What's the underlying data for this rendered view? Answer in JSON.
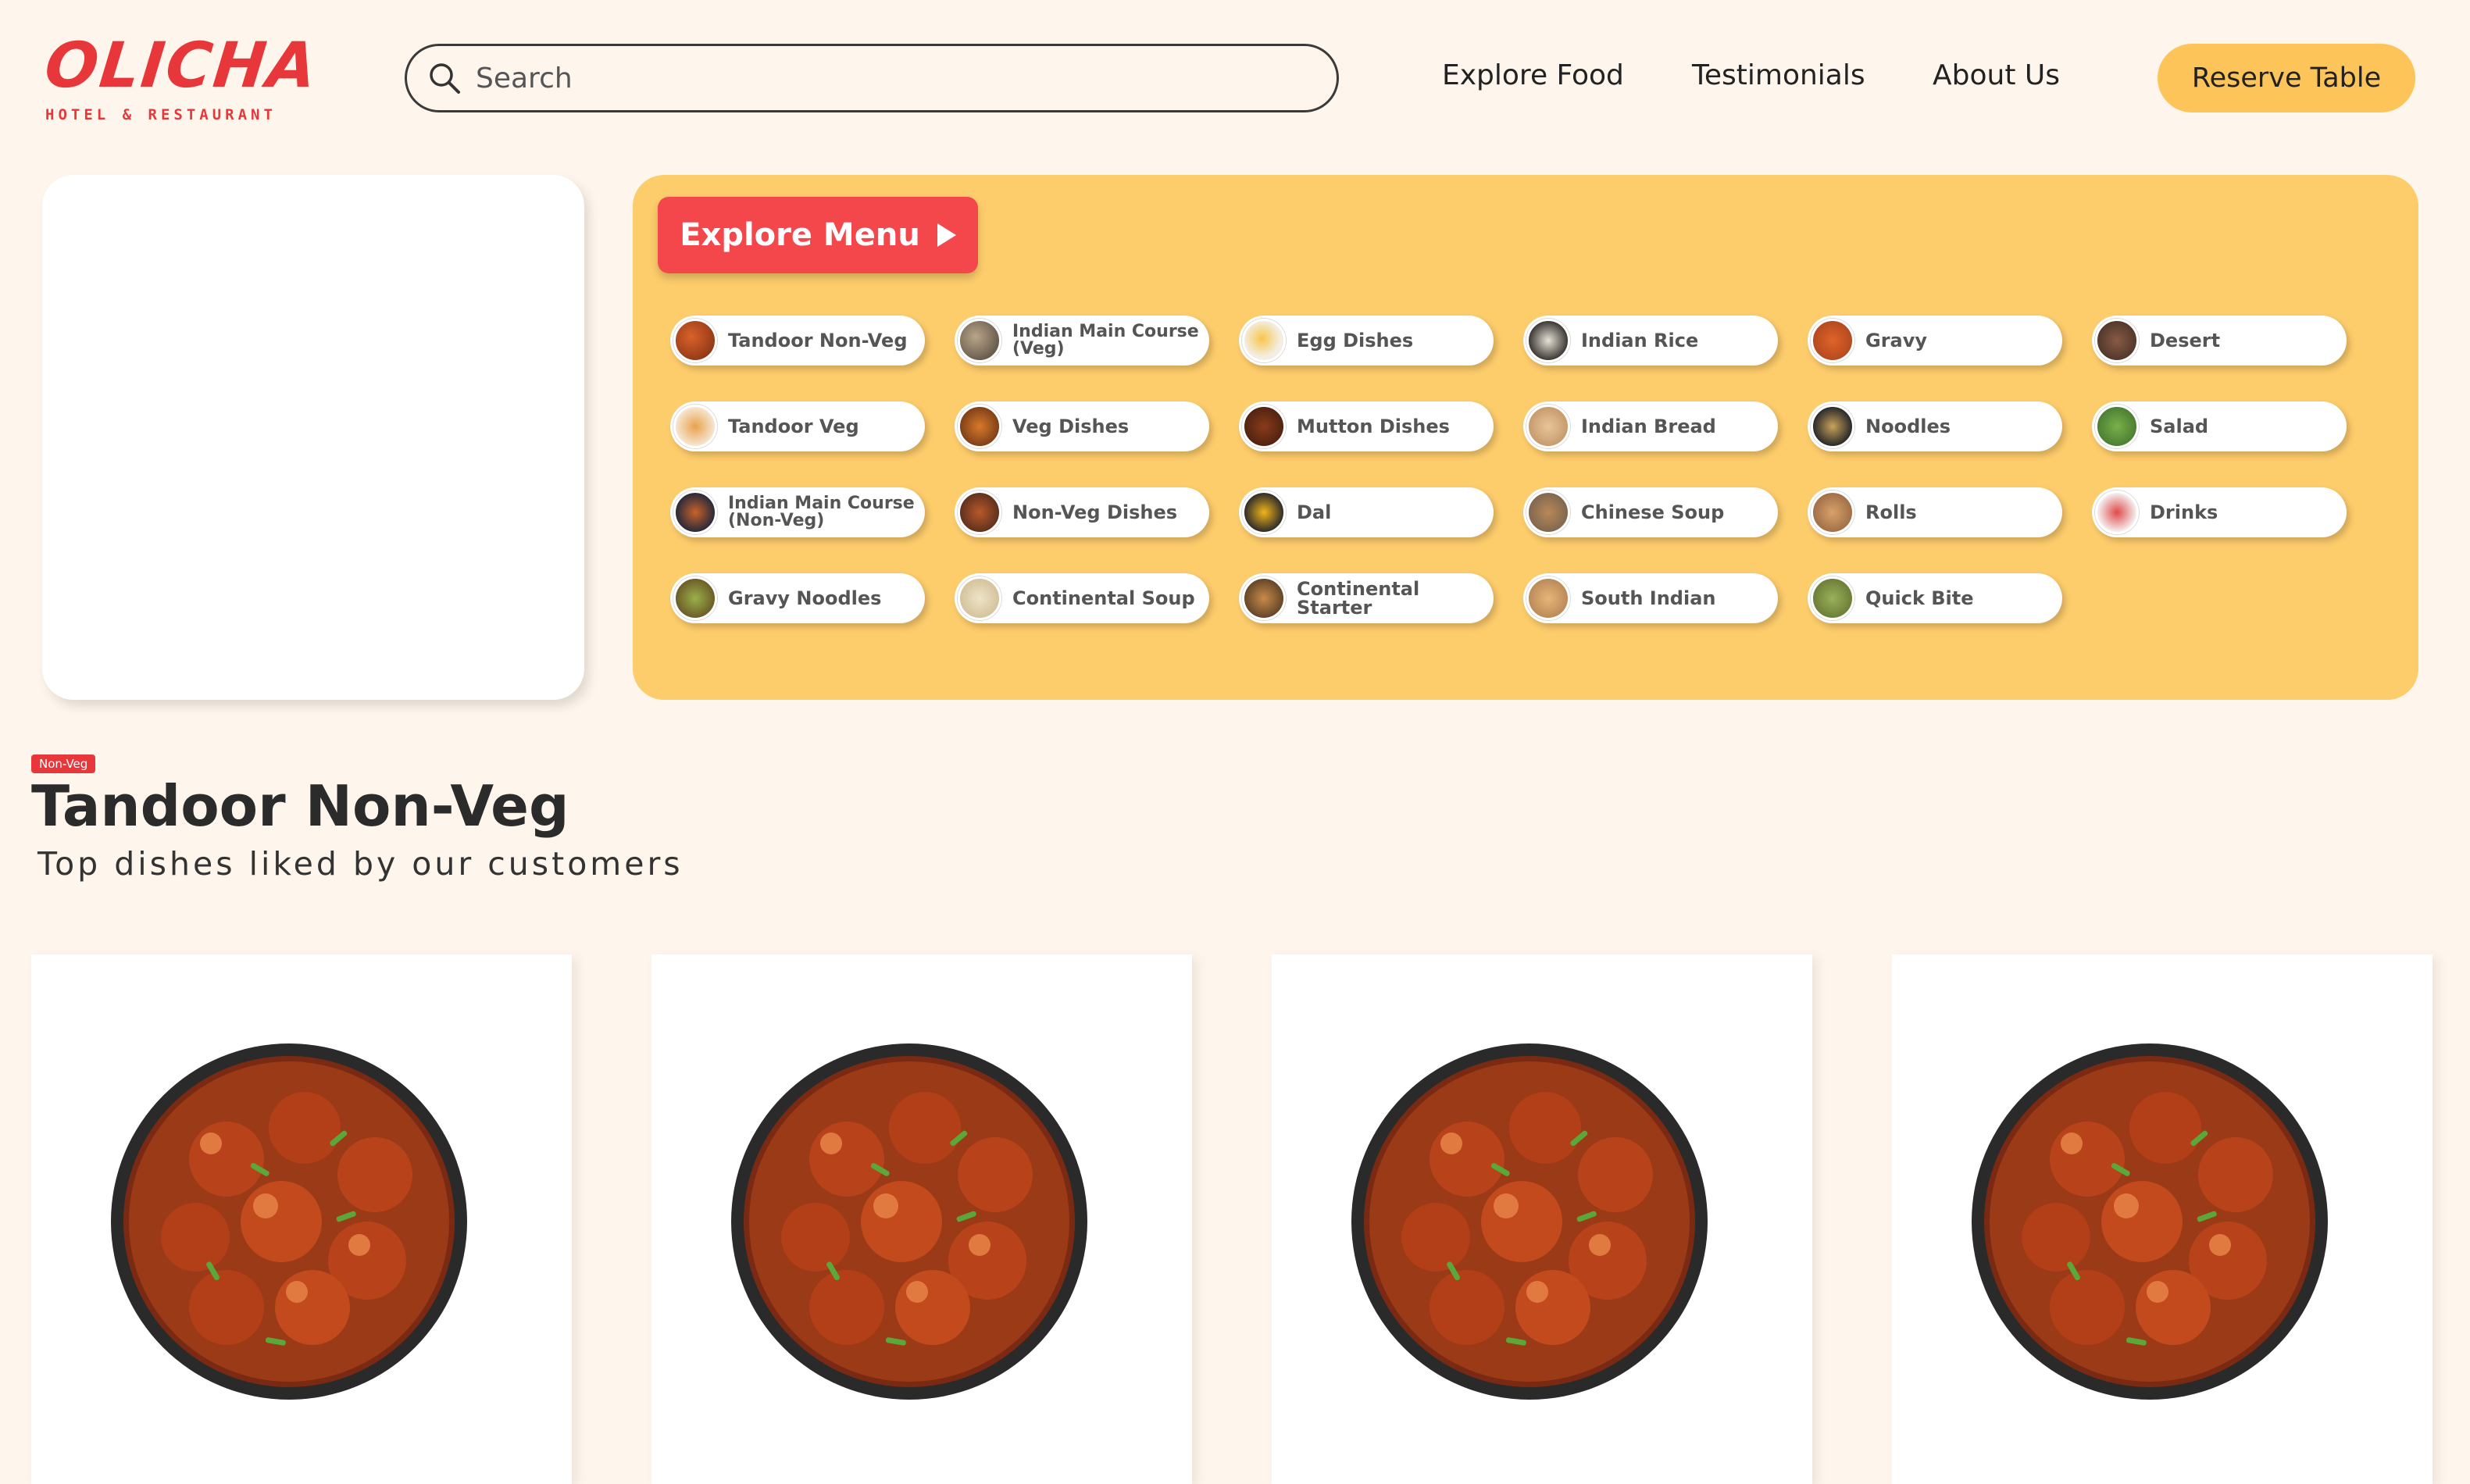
{
  "brand": {
    "name": "OLICHA",
    "tagline": "HOTEL & RESTAURANT",
    "color": "#e8373a"
  },
  "search": {
    "placeholder": "Search"
  },
  "nav": {
    "items": [
      "Explore Food",
      "Testimonials",
      "About Us"
    ],
    "cta": "Reserve Table"
  },
  "colors": {
    "background": "#fef6ec",
    "panel": "#fdcc6b",
    "accent": "#f4474c",
    "cta": "#fdc45a"
  },
  "menu": {
    "explore_label": "Explore Menu",
    "categories": [
      "Tandoor Non-Veg",
      "Indian Main Course\n(Veg)",
      "Egg Dishes",
      "Indian Rice",
      "Gravy",
      "Desert",
      "Tandoor Veg",
      "Veg Dishes",
      "Mutton Dishes",
      "Indian Bread",
      "Noodles",
      "Salad",
      "Indian Main Course\n(Non-Veg)",
      "Non-Veg Dishes",
      "Dal",
      "Chinese Soup",
      "Rolls",
      "Drinks",
      "Gravy Noodles",
      "Continental Soup",
      "Continental Starter",
      "South Indian",
      "Quick Bite"
    ]
  },
  "section": {
    "badge": "Non-Veg",
    "title": "Tandoor Non-Veg",
    "subtitle": "Top dishes liked by our customers"
  }
}
